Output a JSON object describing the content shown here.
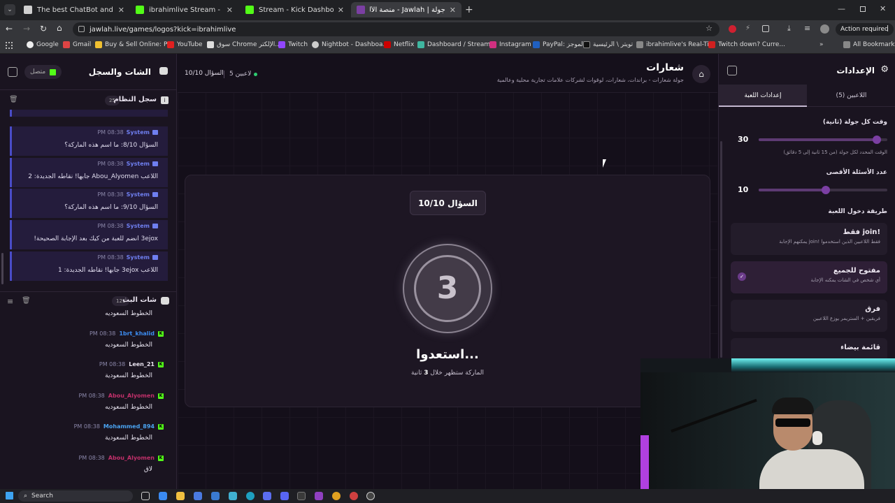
{
  "browser": {
    "tabs": [
      {
        "title": "The best ChatBot and Widgets",
        "color": "#d0d0d0"
      },
      {
        "title": "ibrahimlive Stream - Watch Live",
        "color": "#53fc18"
      },
      {
        "title": "Stream - Kick Dashboard",
        "color": "#53fc18"
      },
      {
        "title": "جولة | Jawlah - منصة الألعاب الت...",
        "color": "#7b3fa3"
      }
    ],
    "url": "jawlah.live/games/logos?kick=ibrahimlive",
    "action_required": "Action required",
    "bookmarks": [
      "Google",
      "Gmail",
      "Buy & Sell Online: P...",
      "YouTube",
      "سوق Chrome الإلكتر...",
      "Twitch",
      "Nightbot - Dashboa...",
      "Netflix",
      "Dashboard / Stream...",
      "Instagram",
      "PayPal: الموجز",
      "تويتر \\ الرئيسية",
      "ibrahimlive's Real-Ti...",
      "Twitch down? Curre..."
    ],
    "all_bookmarks": "All Bookmarks"
  },
  "left": {
    "title": "الشات والسجل",
    "status": "متصل",
    "system_log": {
      "title": "سجل النظام",
      "count": "25"
    },
    "system_messages": [
      {
        "sender": "System",
        "time": "08:38 PM",
        "text": "السؤال 8/10: ما اسم هذه الماركة؟"
      },
      {
        "sender": "System",
        "time": "08:38 PM",
        "text": "اللاعب Abou_Alyomen جابها! نقاطه الجديدة: 2"
      },
      {
        "sender": "System",
        "time": "08:38 PM",
        "text": "السؤال 9/10: ما اسم هذه الماركة؟"
      },
      {
        "sender": "System",
        "time": "08:38 PM",
        "text": "3ejox انضم للعبة من كيك بعد الإجابة الصحيحة!"
      },
      {
        "sender": "System",
        "time": "08:38 PM",
        "text": "اللاعب 3ejox جابها! نقاطه الجديدة: 1"
      }
    ],
    "live_chat": {
      "title": "شات البث",
      "count": "121"
    },
    "chat_messages": [
      {
        "user": "",
        "time": "",
        "text": "الخطوط السعوديه",
        "color": "#fff"
      },
      {
        "user": "1brt_khalid",
        "time": "08:38 PM",
        "text": "الخطوط السعوديه",
        "color": "#3c8cf0"
      },
      {
        "user": "Leen_21",
        "time": "08:38 PM",
        "text": "الخطوط السعودية",
        "color": "#e8e2ee"
      },
      {
        "user": "Abou_Alyomen",
        "time": "08:38 PM",
        "text": "الخطوط السعوديه",
        "color": "#c0306a"
      },
      {
        "user": "Mohammed_894",
        "time": "08:38 PM",
        "text": "الخطوط السعودية",
        "color": "#4aa3f0"
      },
      {
        "user": "Abou_Alyomen",
        "time": "08:38 PM",
        "text": "لاق",
        "color": "#c0306a"
      }
    ]
  },
  "center": {
    "title": "شعارات",
    "subtitle": "جولة شعارات - براندات، شعارات، لوقوات لشركات علامات تجارية محلية وعالمية",
    "players": "5 لاعبين",
    "question_counter": "السؤال 10/10",
    "question_badge": "السؤال 10/10",
    "countdown": "3",
    "get_ready": "استعدوا...",
    "hint_prefix": "الماركة ستظهر خلال",
    "hint_number": "3",
    "hint_suffix": "ثانية"
  },
  "settings": {
    "title": "الإعدادات",
    "tab_players": "اللاعبين (5)",
    "tab_game": "إعدادات اللعبة",
    "round_time_label": "وقت كل جولة (ثانية)",
    "round_time_value": "30",
    "round_time_fraction": 0.92,
    "round_time_hint": "الوقت المحدد لكل جولة (من 15 ثانية إلى 5 دقائق)",
    "max_questions_label": "عدد الأسئلة الأقصى",
    "max_questions_value": "10",
    "max_questions_fraction": 0.52,
    "join_method_label": "طريقة دخول اللعبة",
    "options": [
      {
        "title": "!join فقط",
        "desc": "فقط اللاعبين الذين استخدموا !join يمكنهم الإجابة",
        "selected": false
      },
      {
        "title": "مفتوح للجميع",
        "desc": "أي شخص في الشات يمكنه الإجابة",
        "selected": true
      },
      {
        "title": "فرق",
        "desc": "فريقين + الستريمر يوزع اللاعبين",
        "selected": false
      },
      {
        "title": "قائمة بيضاء",
        "desc": "",
        "selected": false
      }
    ]
  },
  "taskbar": {
    "search": "Search"
  }
}
